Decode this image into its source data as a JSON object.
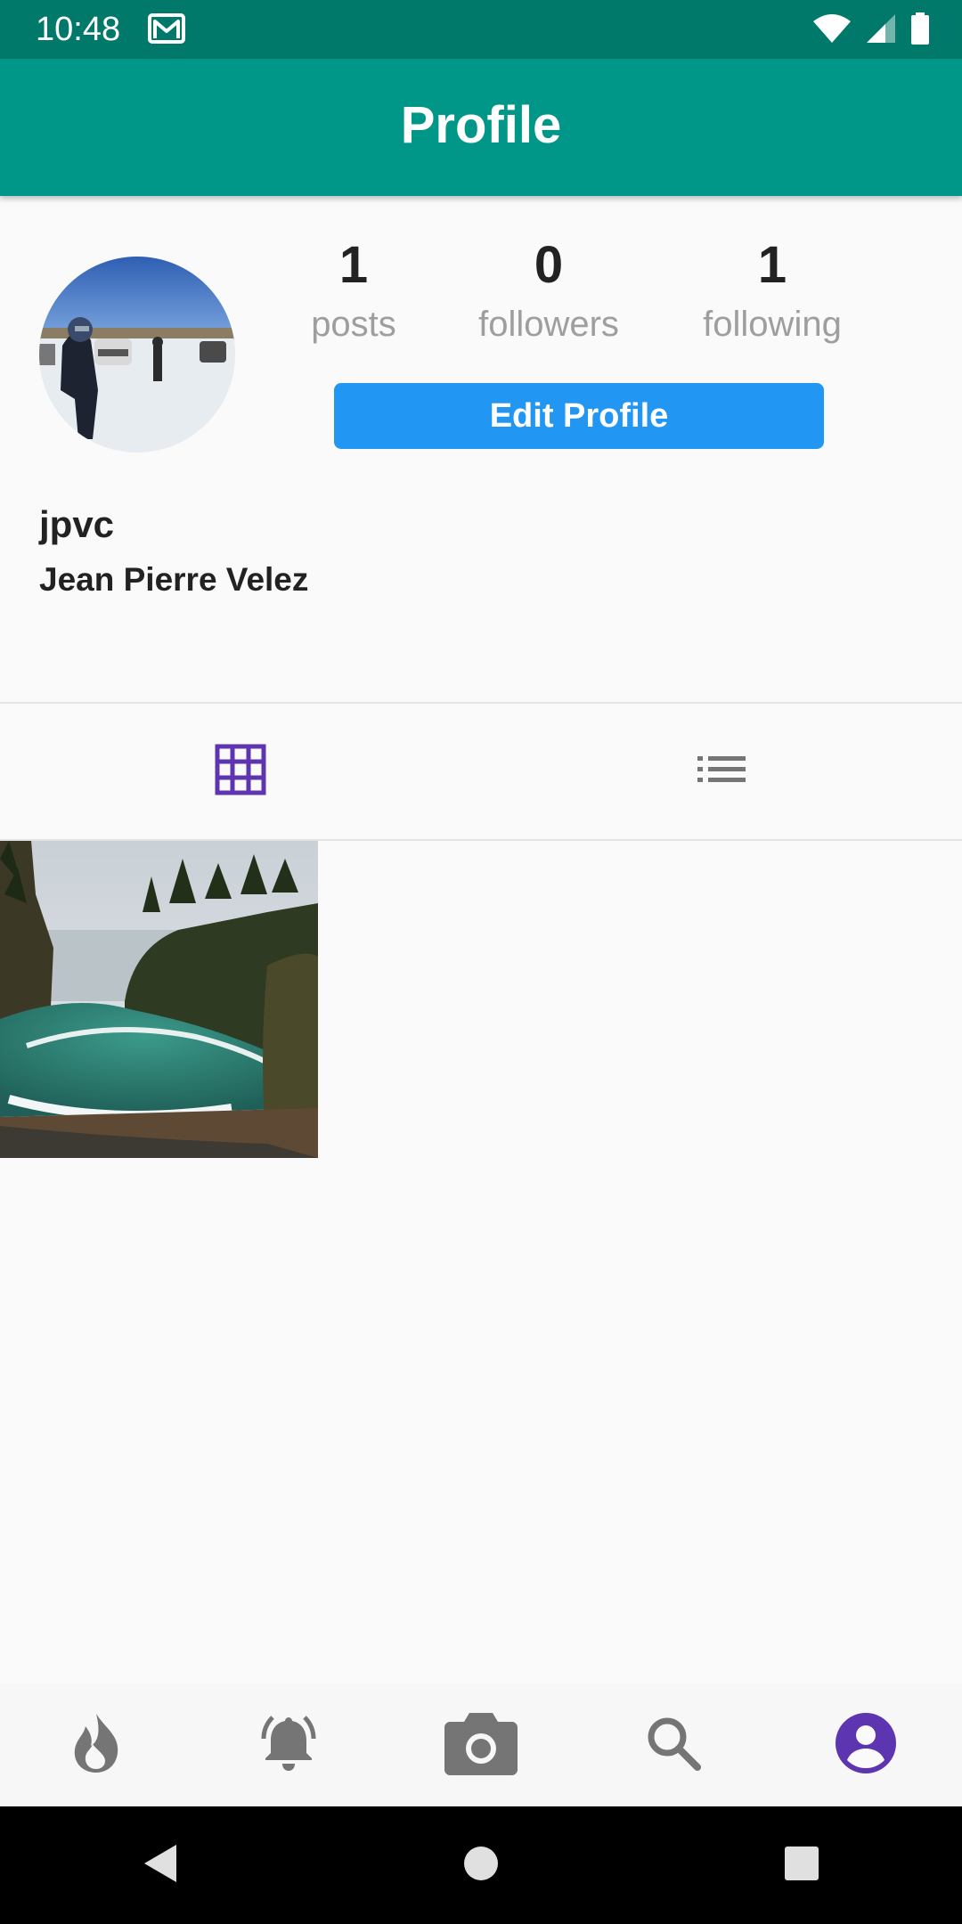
{
  "status_bar": {
    "time": "10:48"
  },
  "app_bar": {
    "title": "Profile"
  },
  "profile": {
    "username": "jpvc",
    "full_name": "Jean Pierre Velez",
    "edit_button_label": "Edit Profile",
    "stats": [
      {
        "value": "1",
        "label": "posts"
      },
      {
        "value": "0",
        "label": "followers"
      },
      {
        "value": "1",
        "label": "following"
      }
    ]
  },
  "tabs": [
    {
      "name": "grid-view",
      "icon": "grid-icon",
      "active": true
    },
    {
      "name": "list-view",
      "icon": "list-icon",
      "active": false
    }
  ],
  "posts_count_shown": 1,
  "bottom_nav": [
    {
      "icon": "flame-icon",
      "active": false
    },
    {
      "icon": "bell-ringing-icon",
      "active": false
    },
    {
      "icon": "camera-icon",
      "active": false
    },
    {
      "icon": "search-icon",
      "active": false
    },
    {
      "icon": "account-circle-icon",
      "active": true
    }
  ],
  "colors": {
    "status_bar": "#00796b",
    "app_bar": "#009688",
    "edit_button": "#2196f3",
    "active_accent": "#5e35b1",
    "inactive_icon": "#757575"
  }
}
